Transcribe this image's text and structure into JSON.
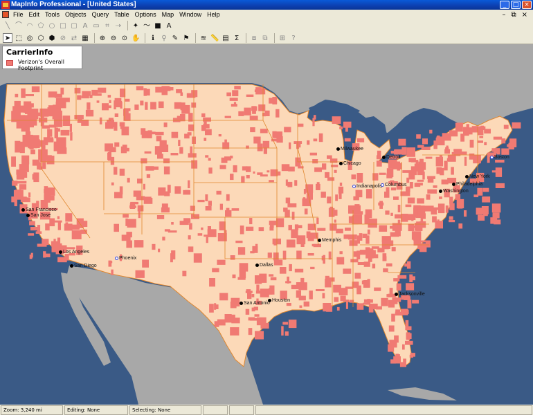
{
  "window": {
    "title": "MapInfo Professional - [United States]"
  },
  "menu": [
    "File",
    "Edit",
    "Tools",
    "Objects",
    "Query",
    "Table",
    "Options",
    "Map",
    "Window",
    "Help"
  ],
  "legend": {
    "title": "CarrierInfo",
    "item": "Verizon's Overall Footprint",
    "swatch_color": "#f07a73"
  },
  "cities": [
    {
      "name": "Milwaukee",
      "marker": "black"
    },
    {
      "name": "Chicago",
      "marker": "black"
    },
    {
      "name": "Detroit",
      "marker": "black"
    },
    {
      "name": "Boston",
      "marker": "blue"
    },
    {
      "name": "New York",
      "marker": "black"
    },
    {
      "name": "Philadelphia",
      "marker": "black"
    },
    {
      "name": "Washington",
      "marker": "black"
    },
    {
      "name": "Indianapolis",
      "marker": "blue"
    },
    {
      "name": "Columbus",
      "marker": "blue"
    },
    {
      "name": "San Francisco",
      "marker": "black"
    },
    {
      "name": "San Jose",
      "marker": "black"
    },
    {
      "name": "Los Angeles",
      "marker": "black"
    },
    {
      "name": "San Diego",
      "marker": "black"
    },
    {
      "name": "Phoenix",
      "marker": "blue"
    },
    {
      "name": "Memphis",
      "marker": "black"
    },
    {
      "name": "Dallas",
      "marker": "black"
    },
    {
      "name": "San Antonio",
      "marker": "black"
    },
    {
      "name": "Houston",
      "marker": "black"
    },
    {
      "name": "Jacksonville",
      "marker": "black"
    }
  ],
  "status": {
    "zoom": "Zoom: 3,240 mi",
    "editing": "Editing: None",
    "selecting": "Selecting: None"
  },
  "colors": {
    "water": "#3a5a86",
    "land_us": "#fcd9b8",
    "land_other": "#a8a8a8",
    "coverage": "#f07a73",
    "borders": "#e0862e"
  }
}
